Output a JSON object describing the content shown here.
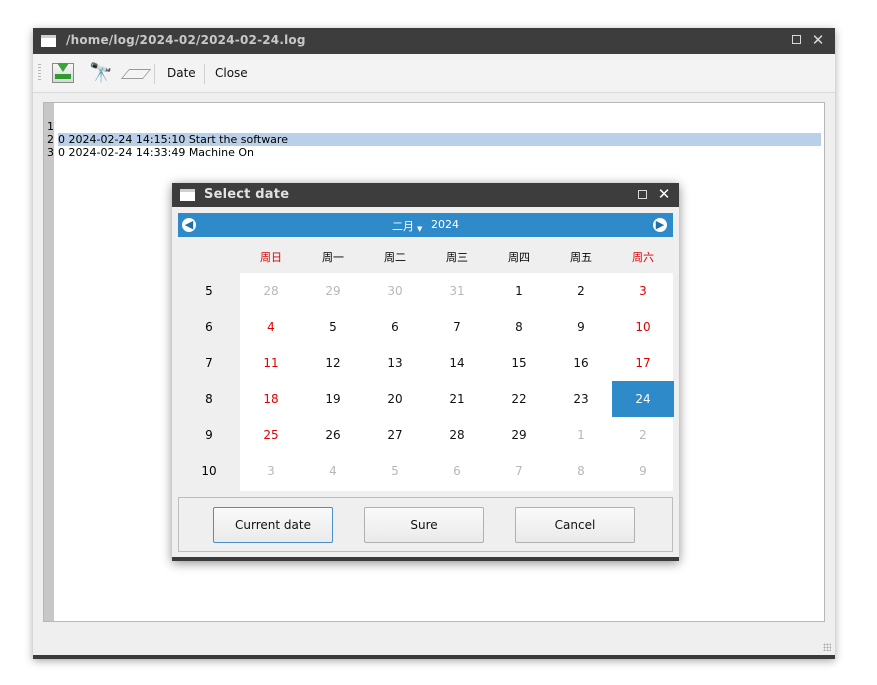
{
  "window": {
    "title": "/home/log/2024-02/2024-02-24.log",
    "toolbar": {
      "load_icon": "load-tray-icon",
      "find_icon": "binoculars-icon",
      "clear_icon": "eraser-icon",
      "date_label": "Date",
      "close_label": "Close"
    },
    "editor": {
      "lines": [
        {
          "num": "1",
          "text": "0 2024-02-24 14:15:10 Start the software"
        },
        {
          "num": "2",
          "text": "0 2024-02-24 14:33:49 Machine On"
        },
        {
          "num": "3",
          "text": ""
        }
      ]
    }
  },
  "dialog": {
    "title": "Select date",
    "month": "二月",
    "year": "2024",
    "weekdays": [
      "周日",
      "周一",
      "周二",
      "周三",
      "周四",
      "周五",
      "周六"
    ],
    "weeks": [
      {
        "week": "5",
        "days": [
          "28",
          "29",
          "30",
          "31",
          "1",
          "2",
          "3"
        ]
      },
      {
        "week": "6",
        "days": [
          "4",
          "5",
          "6",
          "7",
          "8",
          "9",
          "10"
        ]
      },
      {
        "week": "7",
        "days": [
          "11",
          "12",
          "13",
          "14",
          "15",
          "16",
          "17"
        ]
      },
      {
        "week": "8",
        "days": [
          "18",
          "19",
          "20",
          "21",
          "22",
          "23",
          "24"
        ]
      },
      {
        "week": "9",
        "days": [
          "25",
          "26",
          "27",
          "28",
          "29",
          "1",
          "2"
        ]
      },
      {
        "week": "10",
        "days": [
          "3",
          "4",
          "5",
          "6",
          "7",
          "8",
          "9"
        ]
      }
    ],
    "buttons": {
      "current": "Current date",
      "sure": "Sure",
      "cancel": "Cancel"
    }
  },
  "colors": {
    "accent": "#2f8ac9",
    "weekend": "#e00000",
    "other_month": "#b8b8b8",
    "titlebar": "#3d3d3d"
  }
}
